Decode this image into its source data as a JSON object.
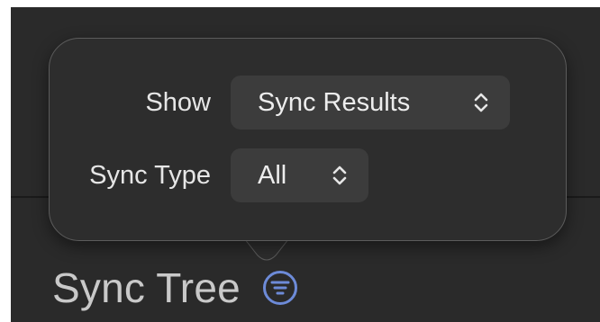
{
  "popover": {
    "show": {
      "label": "Show",
      "value": "Sync Results",
      "icon": "chevron-up-down-icon"
    },
    "sync_type": {
      "label": "Sync Type",
      "value": "All",
      "icon": "chevron-up-down-icon"
    }
  },
  "page": {
    "title": "Sync Tree",
    "filter_icon": "filter-circle-icon"
  },
  "colors": {
    "background": "#2a2a2a",
    "popover_background": "#2d2d2d",
    "popover_border": "#5c5c5c",
    "select_background": "#3c3c3c",
    "accent": "#6d8bd8",
    "title_text": "#c9c9c9",
    "label_text": "#e6e6e6"
  }
}
